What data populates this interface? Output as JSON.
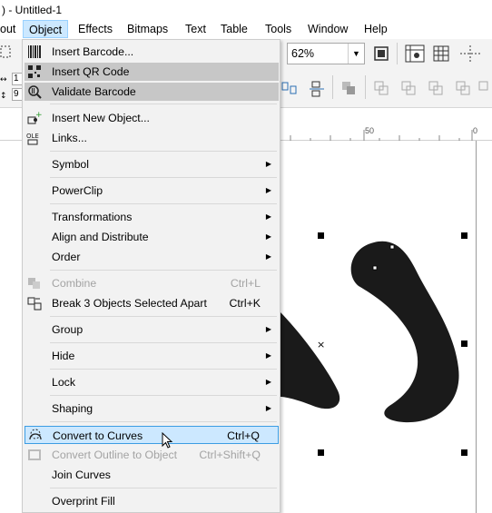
{
  "window": {
    "title": ") - Untitled-1"
  },
  "menubar": {
    "items": [
      {
        "label": "out"
      },
      {
        "label": "Object"
      },
      {
        "label": "Effects"
      },
      {
        "label": "Bitmaps"
      },
      {
        "label": "Text"
      },
      {
        "label": "Table"
      },
      {
        "label": "Tools"
      },
      {
        "label": "Window"
      },
      {
        "label": "Help"
      }
    ]
  },
  "toolbar": {
    "zoom_value": "62%",
    "left_fields": [
      "1",
      "9"
    ]
  },
  "ruler": {
    "labels": [
      "50",
      "0"
    ]
  },
  "object_menu": {
    "items": [
      {
        "label": "Insert Barcode...",
        "shortcut": "",
        "icon": "barcode-icon"
      },
      {
        "label": "Insert QR Code",
        "shortcut": "",
        "icon": "qr-code-icon"
      },
      {
        "label": "Validate Barcode",
        "shortcut": "",
        "icon": "validate-barcode-icon"
      },
      {
        "label": "Insert New Object...",
        "shortcut": "",
        "icon": "insert-object-icon"
      },
      {
        "label": "Links...",
        "shortcut": "",
        "icon": "ole-icon"
      },
      {
        "label": "Symbol",
        "shortcut": ""
      },
      {
        "label": "PowerClip",
        "shortcut": ""
      },
      {
        "label": "Transformations",
        "shortcut": ""
      },
      {
        "label": "Align and Distribute",
        "shortcut": ""
      },
      {
        "label": "Order",
        "shortcut": ""
      },
      {
        "label": "Combine",
        "shortcut": "Ctrl+L",
        "icon": "combine-icon"
      },
      {
        "label": "Break 3 Objects Selected Apart",
        "shortcut": "Ctrl+K",
        "icon": "break-apart-icon"
      },
      {
        "label": "Group",
        "shortcut": ""
      },
      {
        "label": "Hide",
        "shortcut": ""
      },
      {
        "label": "Lock",
        "shortcut": ""
      },
      {
        "label": "Shaping",
        "shortcut": ""
      },
      {
        "label": "Convert to Curves",
        "shortcut": "Ctrl+Q",
        "icon": "convert-curves-icon"
      },
      {
        "label": "Convert Outline to Object",
        "shortcut": "Ctrl+Shift+Q",
        "icon": "outline-to-object-icon"
      },
      {
        "label": "Join Curves",
        "shortcut": ""
      },
      {
        "label": "Overprint Fill",
        "shortcut": ""
      }
    ]
  },
  "colors": {
    "menu_selected_bg": "#cce8ff",
    "menu_selected_border": "#3c9de3",
    "menu_hover_bg": "#c7c7c7",
    "shape_fill": "#1a1a1a"
  }
}
